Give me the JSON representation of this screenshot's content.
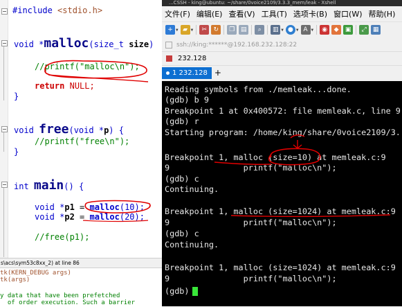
{
  "editor": {
    "lines": {
      "include_kw": "#include",
      "include_file": "<stdio.h>",
      "malloc_ret": "void *",
      "malloc_name": "malloc",
      "malloc_params_open": "(size_t ",
      "malloc_params_arg": "size",
      "malloc_params_close": ")",
      "malloc_comment": "//printf(\"malloc\\n\");",
      "return_kw": "return",
      "return_val": "NULL;",
      "brace_close_1": "}",
      "free_ret": "void ",
      "free_name": "free",
      "free_params": "(void *",
      "free_param_name": "p",
      "free_params_close": ") {",
      "free_comment": "//printf(\"free\\n\");",
      "brace_close_2": "}",
      "main_ret": "int ",
      "main_name": "main",
      "main_params": "() {",
      "p1_type": "void *",
      "p1_name": "p1",
      "p1_assign": " = ",
      "p1_call": "malloc",
      "p1_arg": "(10);",
      "p2_type": "void *",
      "p2_name": "p2",
      "p2_assign": " = ",
      "p2_call": "malloc",
      "p2_arg": "(20);",
      "free_call_comment": "//free(p1);"
    },
    "info_bar": "s\\acs\\sym53c8xx_2) at line 86",
    "info_lines": [
      "tk(KERN_DEBUG args)",
      "tk(args)",
      "",
      "y data that have been prefetched",
      "  of order execution. Such a barrier"
    ]
  },
  "window": {
    "title": "...CSSH - king@ubuntu: ~/share/0voice2109/3.3.3_mem/leak - Xshell",
    "menu": [
      "文件(F)",
      "编辑(E)",
      "查看(V)",
      "工具(T)",
      "选项卡(B)",
      "窗口(W)",
      "帮助(H)"
    ],
    "address": "ssh://king:******@192.168.232.128:22",
    "session_name": "232.128",
    "tab_label": "1 232.128",
    "tab_add": "+",
    "colors": {
      "tab_active": "#0d6fd1",
      "cursor": "#39e639",
      "annotation": "#e00000"
    }
  },
  "terminal": {
    "lines": [
      "Reading symbols from ./memleak...done.",
      "(gdb) b 9",
      "Breakpoint 1 at 0x400572: file memleak.c, line 9.",
      "(gdb) r",
      "Starting program: /home/king/share/0voice2109/3.",
      "",
      "Breakpoint 1, malloc (size=10) at memleak.c:9",
      "9               printf(\"malloc\\n\");",
      "(gdb) c",
      "Continuing.",
      "",
      "Breakpoint 1, malloc (size=1024) at memleak.c:9",
      "9               printf(\"malloc\\n\");",
      "(gdb) c",
      "Continuing.",
      "",
      "Breakpoint 1, malloc (size=1024) at memleak.c:9",
      "9               printf(\"malloc\\n\");",
      "(gdb) "
    ]
  }
}
